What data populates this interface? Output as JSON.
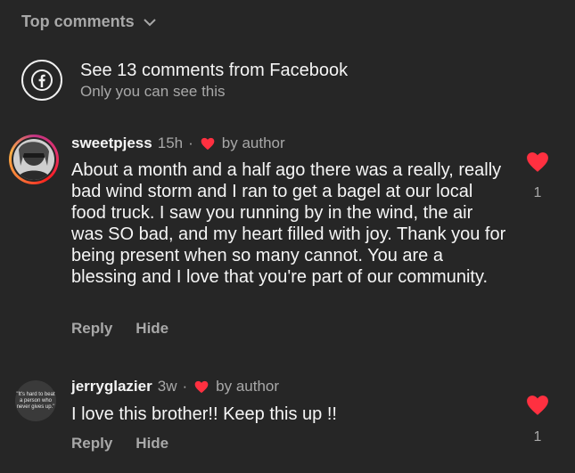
{
  "header": {
    "sort_label": "Top comments"
  },
  "facebook_banner": {
    "title": "See 13 comments from Facebook",
    "subtitle": "Only you can see this"
  },
  "comments": [
    {
      "username": "sweetpjess",
      "time": "15h",
      "separator": "·",
      "author_label": "by author",
      "text": "About a month and a half ago there was a really, really bad wind storm and I ran to get a bagel at our local food truck. I saw you running by in the wind, the air was SO bad, and my heart filled with joy. Thank you for being present when so many cannot. You are a blessing and I love that you're part of our community.",
      "reply_label": "Reply",
      "hide_label": "Hide",
      "like_count": "1"
    },
    {
      "username": "jerryglazier",
      "time": "3w",
      "separator": "·",
      "author_label": "by author",
      "text": "I love this brother!! Keep this up !!",
      "reply_label": "Reply",
      "hide_label": "Hide",
      "like_count": "1",
      "avatar_text": "\"It's hard to beat a person who never gives up.\""
    }
  ],
  "colors": {
    "background": "#262626",
    "heart": "#ff3040",
    "muted": "#a8a8a8"
  }
}
